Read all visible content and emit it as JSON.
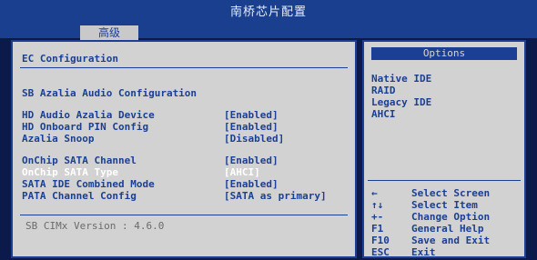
{
  "window": {
    "title": "南桥芯片配置"
  },
  "tabs": [
    {
      "label": "高级"
    }
  ],
  "main": {
    "section_1": "EC Configuration",
    "section_2": "SB Azalia Audio Configuration",
    "azalia_items": [
      {
        "label": "HD Audio Azalia Device",
        "value": "[Enabled]"
      },
      {
        "label": "HD Onboard PIN Config",
        "value": "[Enabled]"
      },
      {
        "label": "Azalia Snoop",
        "value": "[Disabled]"
      }
    ],
    "sata_items": [
      {
        "label": "OnChip SATA Channel",
        "value": "[Enabled]"
      },
      {
        "label": "OnChip SATA Type",
        "value": "[AHCI]"
      },
      {
        "label": "SATA IDE Combined Mode",
        "value": "[Enabled]"
      },
      {
        "label": "PATA Channel Config",
        "value": "[SATA as primary]"
      }
    ],
    "version": "SB CIMx Version : 4.6.0"
  },
  "options": {
    "header": "Options",
    "items": [
      "Native IDE",
      "RAID",
      "Legacy IDE",
      "AHCI"
    ]
  },
  "help": [
    {
      "key": "←",
      "desc": "Select Screen"
    },
    {
      "key": "↑↓",
      "desc": "Select Item"
    },
    {
      "key": "+-",
      "desc": "Change Option"
    },
    {
      "key": "F1",
      "desc": "General Help"
    },
    {
      "key": "F10",
      "desc": "Save and Exit"
    },
    {
      "key": "ESC",
      "desc": "Exit"
    }
  ],
  "colors": {
    "bios_blue": "#1b3f94",
    "panel_gray": "#d2d2d2",
    "selected_text": "#ffffff"
  }
}
